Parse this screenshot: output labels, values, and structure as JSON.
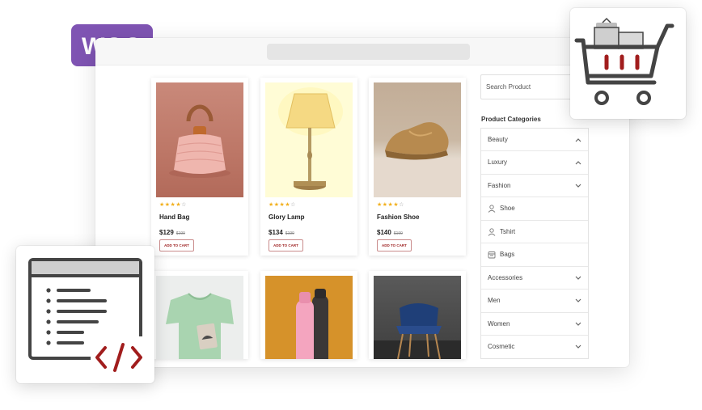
{
  "brand": {
    "logo_text": "WOO",
    "logo_color": "#7f54b3"
  },
  "browser": {
    "address": ""
  },
  "products": [
    {
      "name": "Hand Bag",
      "price": "$129",
      "old_price": "$199",
      "rating": 4,
      "button": "ADD TO CART",
      "image": "pink-knitted-handbag"
    },
    {
      "name": "Glory Lamp",
      "price": "$134",
      "old_price": "$199",
      "rating": 4,
      "button": "ADD TO CART",
      "image": "table-lamp"
    },
    {
      "name": "Fashion Shoe",
      "price": "$140",
      "old_price": "$199",
      "rating": 4,
      "button": "ADD TO CART",
      "image": "gold-sneaker"
    },
    {
      "image": "green-tshirt"
    },
    {
      "image": "pink-black-bottles"
    },
    {
      "image": "blue-chair"
    }
  ],
  "sidebar": {
    "search_placeholder": "Search Product",
    "categories_title": "Product Categories",
    "categories": [
      {
        "label": "Beauty",
        "chevron": "up"
      },
      {
        "label": "Luxury",
        "chevron": "up"
      },
      {
        "label": "Fashion",
        "chevron": "down"
      }
    ],
    "subcategories": [
      {
        "label": "Shoe",
        "icon": "user-icon"
      },
      {
        "label": "Tshirt",
        "icon": "user-icon"
      },
      {
        "label": "Bags",
        "icon": "calendar-icon"
      }
    ],
    "more_categories": [
      {
        "label": "Accessories",
        "chevron": "down"
      },
      {
        "label": "Men",
        "chevron": "down"
      },
      {
        "label": "Women",
        "chevron": "down"
      },
      {
        "label": "Cosmetic",
        "chevron": "down"
      }
    ]
  },
  "colors": {
    "accent": "#9b1c1c",
    "star": "#f2b01e",
    "woo_purple": "#7f54b3",
    "cart_red": "#a11d1d",
    "icon_gray": "#444444"
  }
}
